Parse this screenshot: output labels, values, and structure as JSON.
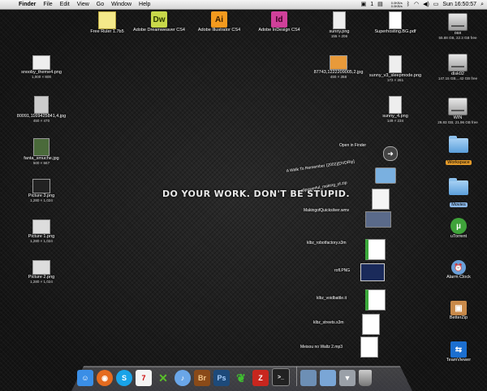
{
  "menubar": {
    "apple": "",
    "app_name": "Finder",
    "items": [
      "File",
      "Edit",
      "View",
      "Go",
      "Window",
      "Help"
    ],
    "badge": "1",
    "net_up": "0.0KB/s",
    "net_down": "0.0KB/s",
    "clock": "Sun 16:50:57"
  },
  "desktop_top": [
    {
      "label": "Free Ruler 1.7b5",
      "icon": "ruler-app-icon"
    },
    {
      "label": "Adobe Dreamweaver CS4",
      "abbr": "Dw",
      "color": "#c8d84a"
    },
    {
      "label": "Adobe Illustrator CS4",
      "abbr": "Ai",
      "color": "#f39a1e"
    },
    {
      "label": "Adobe InDesign CS4",
      "abbr": "Id",
      "color": "#d0409a"
    }
  ],
  "desktop_right_files": [
    {
      "label": "sunny.png",
      "sub": "155 × 206"
    },
    {
      "label": "Superhosting.BG.pdf",
      "sub": ""
    },
    {
      "label": "87743,1222209005,2.jpg",
      "sub": "450 × 358"
    },
    {
      "label": "sunny_v3_sleepmode.png",
      "sub": "172 × 261"
    },
    {
      "label": "sunny_4.png",
      "sub": "149 × 234"
    }
  ],
  "desktop_left_files": [
    {
      "label": "snooby_theme4.png",
      "sub": "1,000 × 800"
    },
    {
      "label": "80091,1169425841,4.jpg",
      "sub": "450 × 470"
    },
    {
      "label": "fanta_smuche.jpg",
      "sub": "500 × 667"
    },
    {
      "label": "Picture 3.png",
      "sub": "1,280 × 1,024"
    },
    {
      "label": "Picture 1.png",
      "sub": "1,280 × 1,024"
    },
    {
      "label": "Picture 2.png",
      "sub": "1,280 × 1,024"
    }
  ],
  "drives": [
    {
      "label": "osx",
      "sub": "55.88 GB, 22.3 GB free"
    },
    {
      "label": "disk02",
      "sub": "147.15 GB,...42 GB free"
    },
    {
      "label": "WIN",
      "sub": "29.83 GB, 21.96 GB free"
    }
  ],
  "right_column": [
    {
      "label": "Workspace",
      "type": "folder-orange"
    },
    {
      "label": "Movies",
      "type": "folder-blue"
    },
    {
      "label": "uTorrent",
      "type": "app"
    },
    {
      "label": "Alarm Clock",
      "type": "app"
    },
    {
      "label": "BetterZip",
      "type": "app"
    },
    {
      "label": "TeamViewer",
      "type": "app"
    }
  ],
  "tagline": "DO YOUR WORK. DON'T BE STUPID.",
  "stack": {
    "open_in_finder": "Open in Finder",
    "items": [
      "A Walk To Remember (2002)[DVDRip]",
      "allpowerful_making_of.zip",
      "MakingofQuicksilver.wmv",
      "klbz_robotfactory.s3m",
      "rofl.PNG",
      "klbz_voidbattle.it",
      "klbz_streets.s3m",
      "Meisou no Waltz 2.mp3"
    ]
  },
  "dock": {
    "apps": [
      {
        "name": "finder-icon",
        "glyph": "☺",
        "color": "#3a8ee6"
      },
      {
        "name": "firefox-icon",
        "glyph": "◉",
        "color": "#e56b1f"
      },
      {
        "name": "skype-icon",
        "glyph": "S",
        "color": "#19a3e8"
      },
      {
        "name": "ical-icon",
        "glyph": "7",
        "color": "#e8e8e8"
      },
      {
        "name": "crossover-icon",
        "glyph": "✕",
        "color": "#5a9c28"
      },
      {
        "name": "itunes-icon",
        "glyph": "♪",
        "color": "#6aa6e8"
      },
      {
        "name": "bridge-icon",
        "glyph": "Br",
        "color": "#8a4a18"
      },
      {
        "name": "photoshop-icon",
        "glyph": "Ps",
        "color": "#1d4a7a"
      },
      {
        "name": "leaf-icon",
        "glyph": "❦",
        "color": "#3fa530"
      },
      {
        "name": "filezilla-icon",
        "glyph": "Z",
        "color": "#c8261e"
      },
      {
        "name": "terminal-icon",
        "glyph": ">_",
        "color": "#222"
      }
    ],
    "right": [
      {
        "name": "downloads-stack-icon",
        "glyph": "",
        "color": "#6d8fb5"
      },
      {
        "name": "documents-folder-icon",
        "glyph": "",
        "color": "#7aa6d6"
      },
      {
        "name": "stack-open-icon",
        "glyph": "▼",
        "color": "#aaa"
      },
      {
        "name": "trash-icon",
        "glyph": "",
        "color": "#999"
      }
    ]
  }
}
